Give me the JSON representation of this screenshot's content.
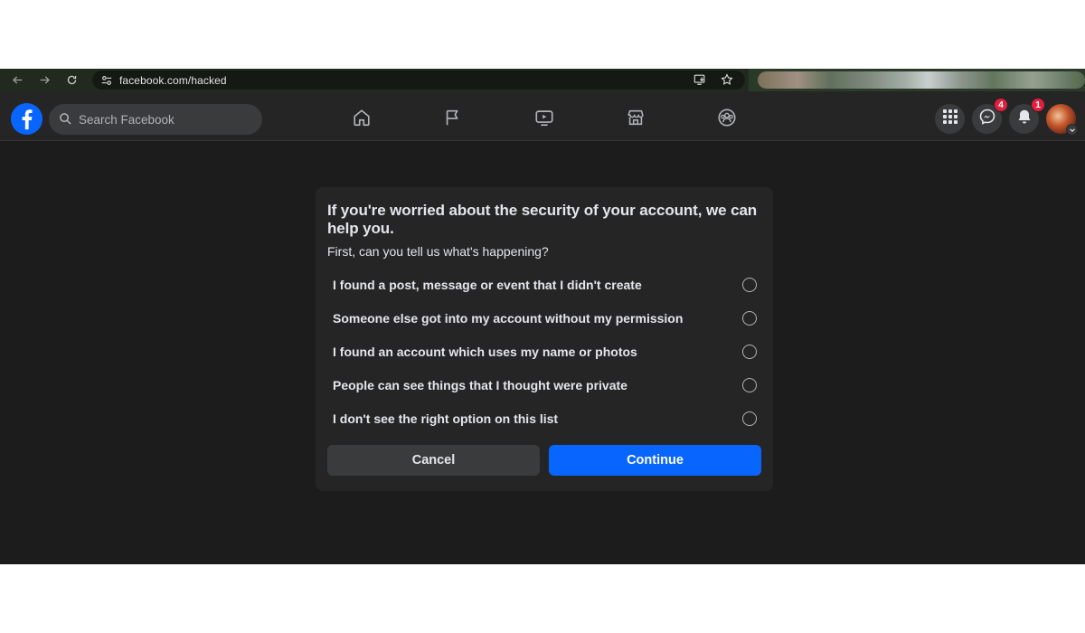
{
  "browser": {
    "url": "facebook.com/hacked"
  },
  "facebook": {
    "search_placeholder": "Search Facebook",
    "nav_tabs": [
      "home-icon",
      "flag-icon",
      "video-icon",
      "marketplace-icon",
      "groups-icon"
    ],
    "messenger_badge": "4",
    "notifications_badge": "1"
  },
  "dialog": {
    "title": "If you're worried about the security of your account, we can help you.",
    "subtitle": "First, can you tell us what's happening?",
    "options": [
      "I found a post, message or event that I didn't create",
      "Someone else got into my account without my permission",
      "I found an account which uses my name or photos",
      "People can see things that I thought were private",
      "I don't see the right option on this list"
    ],
    "cancel_label": "Cancel",
    "continue_label": "Continue"
  },
  "colors": {
    "accent": "#0866ff",
    "badge": "#e41e3f",
    "background": "#1c1c1d",
    "surface": "#252526"
  }
}
